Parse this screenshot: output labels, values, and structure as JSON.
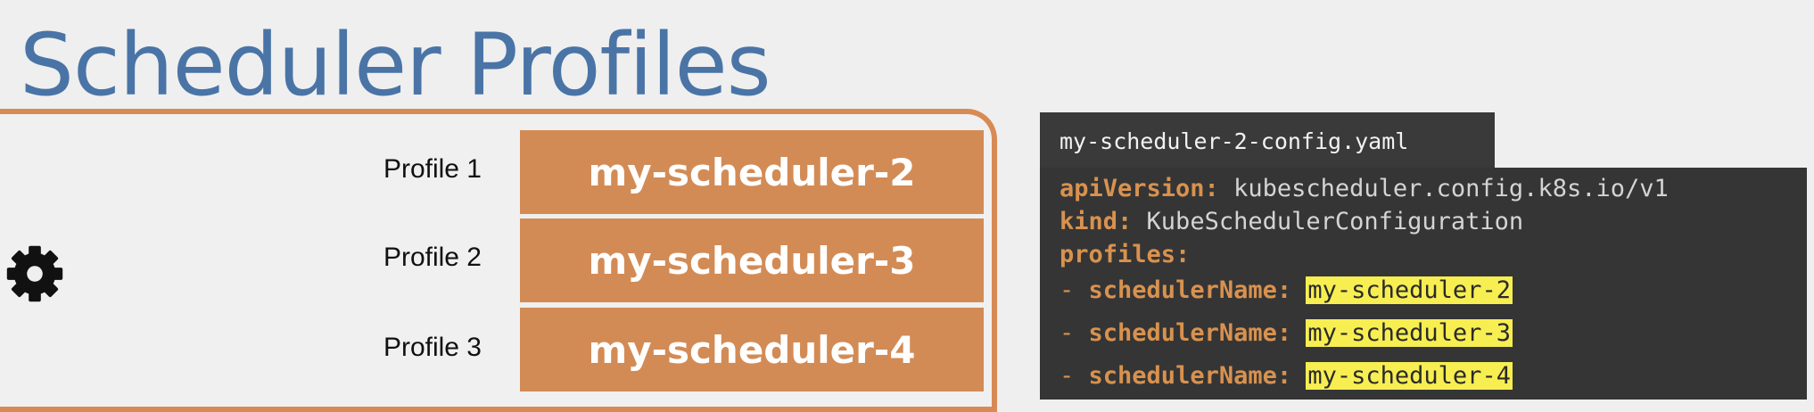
{
  "title": "Scheduler Profiles",
  "profiles": [
    {
      "label": "Profile 1",
      "name": "my-scheduler-2"
    },
    {
      "label": "Profile 2",
      "name": "my-scheduler-3"
    },
    {
      "label": "Profile 3",
      "name": "my-scheduler-4"
    }
  ],
  "file": {
    "tab_name": "my-scheduler-2-config.yaml",
    "api_key": "apiVersion:",
    "api_val": "kubescheduler.config.k8s.io/v1",
    "kind_key": "kind:",
    "kind_val": "KubeSchedulerConfiguration",
    "profiles_key": "profiles:",
    "dash": "-",
    "sched_key": "schedulerName:",
    "sched_vals": [
      "my-scheduler-2",
      "my-scheduler-3",
      "my-scheduler-4"
    ]
  },
  "icons": {
    "gear": "gear-icon"
  },
  "colors": {
    "accent_orange": "#d38b55",
    "title_blue": "#4a74a6",
    "code_bg": "#353535",
    "highlight": "#f7ee52"
  }
}
